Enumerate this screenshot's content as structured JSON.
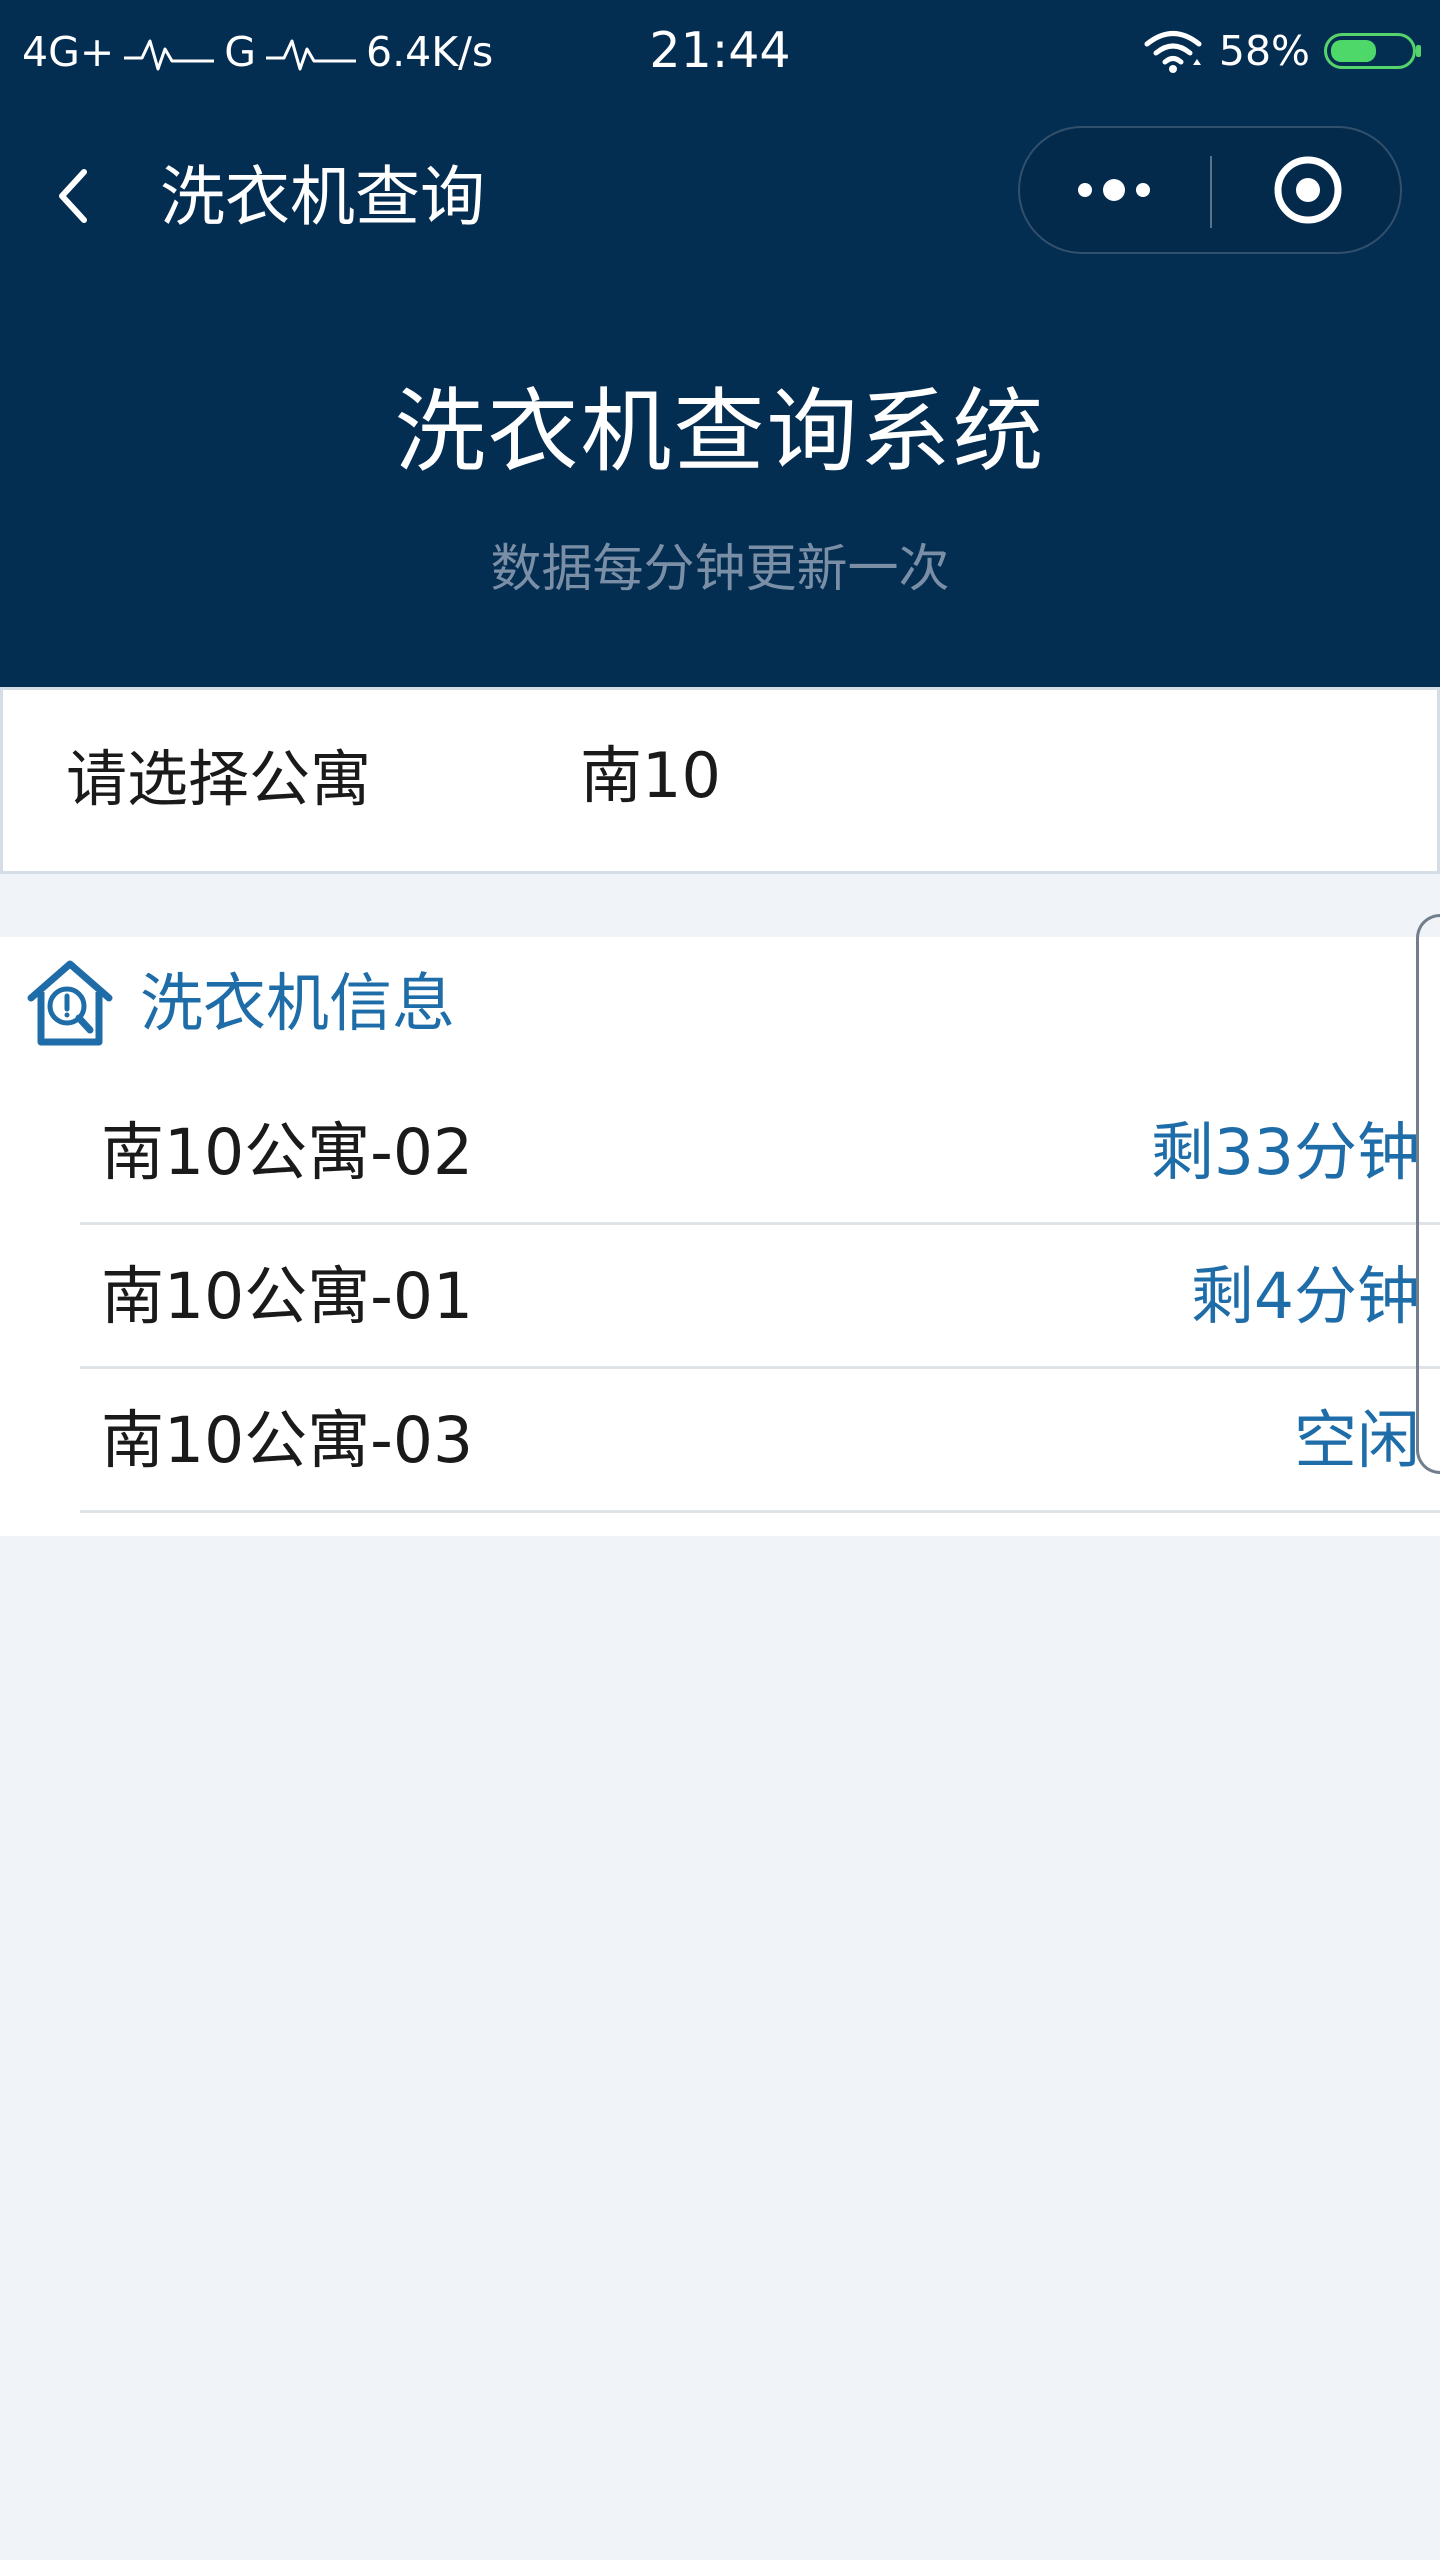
{
  "status_bar": {
    "network": "4G+",
    "network2": "G",
    "speed": "6.4K/s",
    "time": "21:44",
    "battery": "58%",
    "battery_level": 0.58
  },
  "nav": {
    "title": "洗衣机查询"
  },
  "hero": {
    "title": "洗衣机查询系统",
    "subtitle": "数据每分钟更新一次"
  },
  "selector": {
    "label": "请选择公寓",
    "value": "南10"
  },
  "info": {
    "title": "洗衣机信息",
    "machines": [
      {
        "name": "南10公寓-02",
        "status": "剩33分钟"
      },
      {
        "name": "南10公寓-01",
        "status": "剩4分钟"
      },
      {
        "name": "南10公寓-03",
        "status": "空闲"
      }
    ]
  },
  "colors": {
    "header_background": "#042d52",
    "accent": "#1f6da8",
    "page_background": "#f0f4f8",
    "battery": "#4ed86a"
  }
}
